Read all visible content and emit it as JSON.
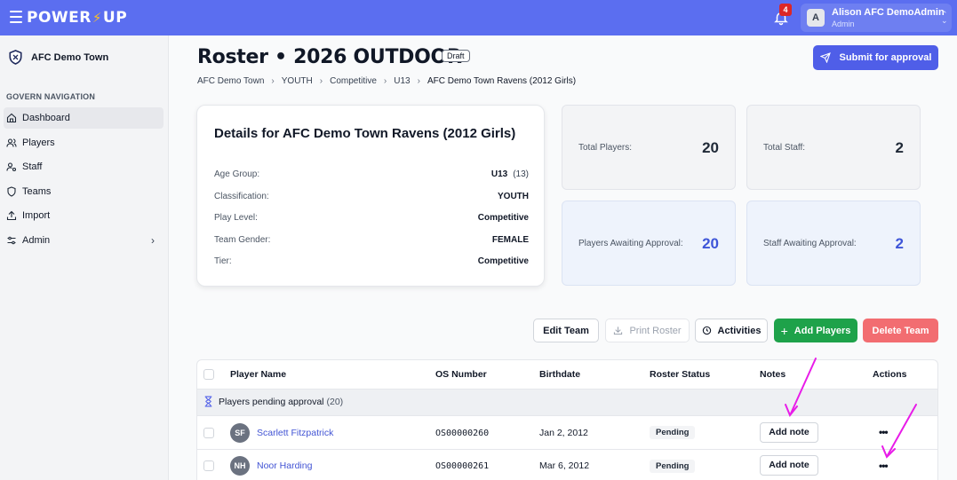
{
  "app": {
    "logo": {
      "left": "POWER",
      "right": "UP"
    },
    "notifications_count": "4",
    "user": {
      "initial": "A",
      "name": "Alison AFC DemoAdmin",
      "role": "Admin"
    }
  },
  "sidebar": {
    "org_name": "AFC Demo Town",
    "section_title": "GOVERN NAVIGATION",
    "items": [
      {
        "label": "Dashboard",
        "icon": "home-icon",
        "active": true
      },
      {
        "label": "Players",
        "icon": "users-icon"
      },
      {
        "label": "Staff",
        "icon": "user-gear-icon"
      },
      {
        "label": "Teams",
        "icon": "shield-icon"
      },
      {
        "label": "Import",
        "icon": "upload-icon"
      },
      {
        "label": "Admin",
        "icon": "sliders-icon",
        "has_submenu": true
      }
    ]
  },
  "header": {
    "title": "Roster • 2026 OUTDOOR",
    "status_badge": "Draft",
    "submit_label": "Submit for approval",
    "breadcrumbs": [
      "AFC Demo Town",
      "YOUTH",
      "Competitive",
      "U13",
      "AFC Demo Town Ravens (2012 Girls)"
    ]
  },
  "details": {
    "title": "Details for AFC Demo Town Ravens (2012 Girls)",
    "rows": [
      {
        "key": "Age Group:",
        "value": "U13",
        "sub": "(13)"
      },
      {
        "key": "Classification:",
        "value": "YOUTH"
      },
      {
        "key": "Play Level:",
        "value": "Competitive"
      },
      {
        "key": "Team Gender:",
        "value": "FEMALE"
      },
      {
        "key": "Tier:",
        "value": "Competitive"
      }
    ]
  },
  "stats": {
    "total_players": {
      "label": "Total Players:",
      "value": "20"
    },
    "total_staff": {
      "label": "Total Staff:",
      "value": "2"
    },
    "players_awaiting": {
      "label": "Players Awaiting Approval:",
      "value": "20"
    },
    "staff_awaiting": {
      "label": "Staff Awaiting Approval:",
      "value": "2"
    }
  },
  "actions": {
    "edit_team": "Edit Team",
    "print_roster": "Print Roster",
    "activities": "Activities",
    "add_players": "Add Players",
    "delete_team": "Delete Team"
  },
  "table": {
    "columns": {
      "player_name": "Player Name",
      "os_number": "OS Number",
      "birthdate": "Birthdate",
      "roster_status": "Roster Status",
      "notes": "Notes",
      "actions": "Actions"
    },
    "group": {
      "label": "Players pending approval",
      "count": "(20)"
    },
    "rows": [
      {
        "initials": "SF",
        "name": "Scarlett Fitzpatrick",
        "os_number": "OS00000260",
        "birthdate": "Jan 2, 2012",
        "status": "Pending",
        "note_button": "Add note",
        "actions": "•••"
      },
      {
        "initials": "NH",
        "name": "Noor Harding",
        "os_number": "OS00000261",
        "birthdate": "Mar 6, 2012",
        "status": "Pending",
        "note_button": "Add note",
        "actions": "•••"
      }
    ]
  },
  "colors": {
    "topbar": "#5b6ef0",
    "primary": "#4f5ee8",
    "success": "#1ea24a",
    "danger": "#f26d71",
    "annotation_arrow": "#e81ce8"
  }
}
